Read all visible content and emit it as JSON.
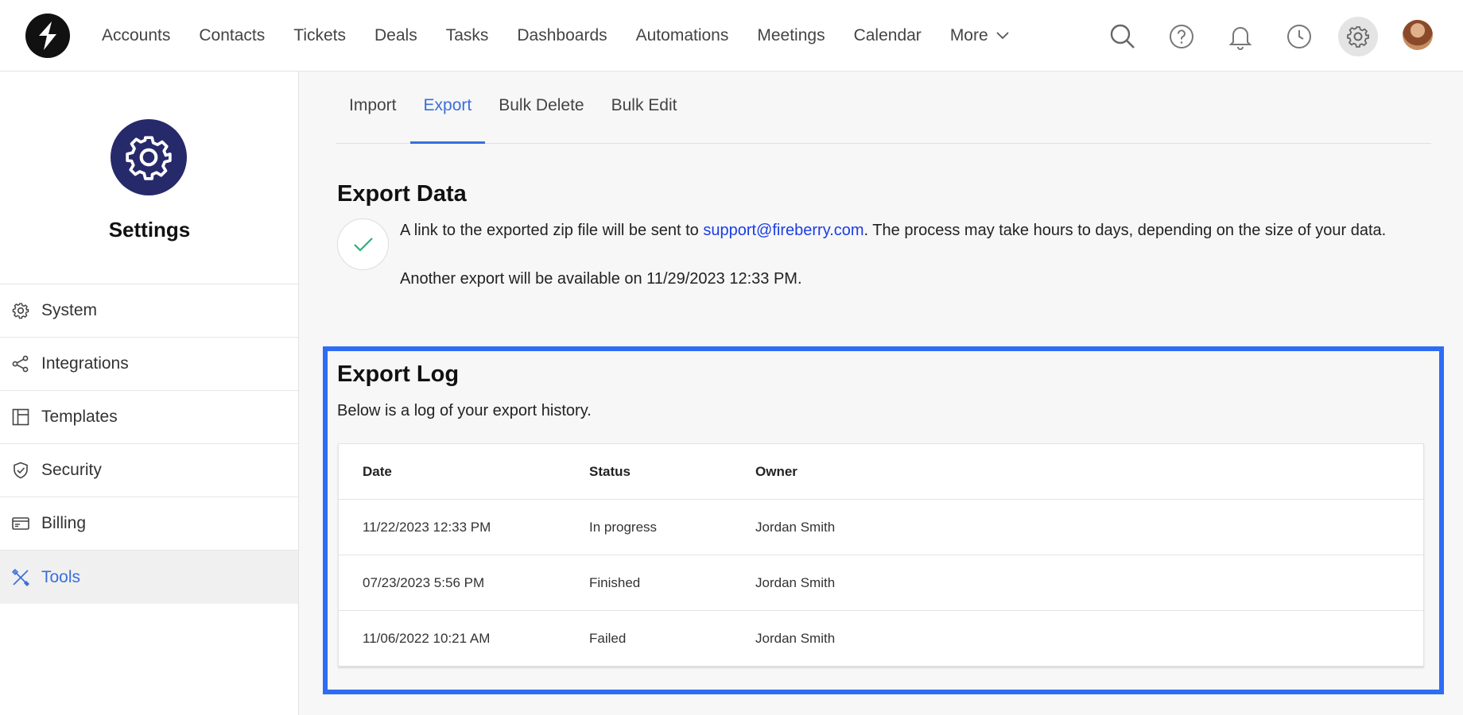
{
  "nav": {
    "items": [
      "Accounts",
      "Contacts",
      "Tickets",
      "Deals",
      "Tasks",
      "Dashboards",
      "Automations",
      "Meetings",
      "Calendar",
      "More"
    ]
  },
  "top_icons": [
    "search-icon",
    "help-icon",
    "bell-icon",
    "clock-icon",
    "gear-icon",
    "avatar"
  ],
  "sidebar": {
    "title": "Settings",
    "items": [
      {
        "label": "System",
        "icon": "gear-icon"
      },
      {
        "label": "Integrations",
        "icon": "share-icon"
      },
      {
        "label": "Templates",
        "icon": "layout-icon"
      },
      {
        "label": "Security",
        "icon": "shield-icon"
      },
      {
        "label": "Billing",
        "icon": "card-icon"
      },
      {
        "label": "Tools",
        "icon": "tools-icon",
        "active": true
      }
    ]
  },
  "tabs": [
    "Import",
    "Export",
    "Bulk Delete",
    "Bulk Edit"
  ],
  "active_tab": "Export",
  "export": {
    "title": "Export Data",
    "desc_prefix": "A link to the exported zip file will be sent to ",
    "email": "support@fireberry.com",
    "desc_suffix": ". The process may take hours to days, depending on the size of your data.",
    "availability": "Another export will be available on 11/29/2023 12:33 PM."
  },
  "log": {
    "title": "Export Log",
    "subtitle": "Below is a log of your export history.",
    "columns": [
      "Date",
      "Status",
      "Owner"
    ],
    "rows": [
      {
        "date": "11/22/2023 12:33 PM",
        "status": "In progress",
        "owner": "Jordan Smith"
      },
      {
        "date": "07/23/2023 5:56 PM",
        "status": "Finished",
        "owner": "Jordan Smith"
      },
      {
        "date": "11/06/2022 10:21 AM",
        "status": "Failed",
        "owner": "Jordan Smith"
      }
    ]
  },
  "colors": {
    "accent": "#3a6fd8",
    "badge": "#262a6b",
    "highlight_frame": "#2e6cf6",
    "check": "#2fae7a",
    "link": "#1a3de6"
  }
}
